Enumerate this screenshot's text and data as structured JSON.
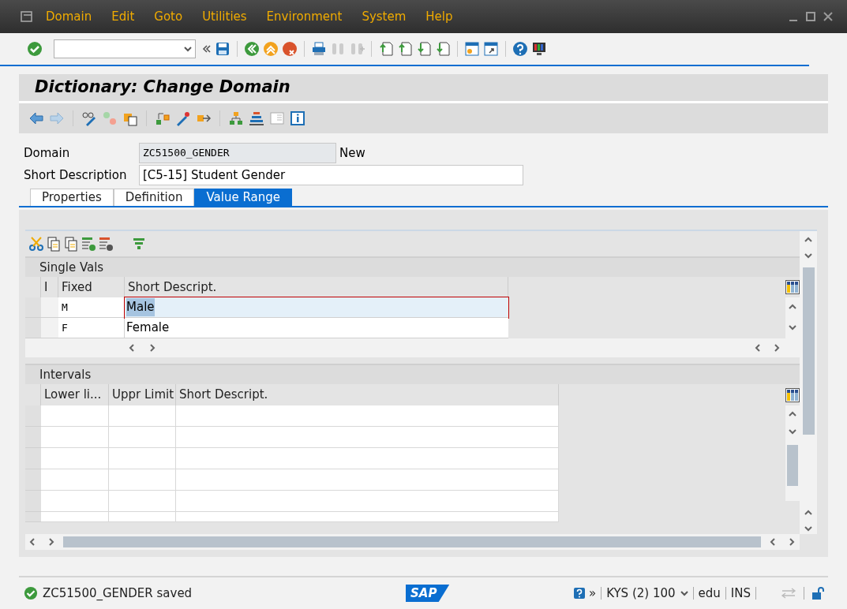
{
  "menu_bar": {
    "items": [
      "Domain",
      "Edit",
      "Goto",
      "Utilities",
      "Environment",
      "System",
      "Help"
    ]
  },
  "screen_title": "Dictionary: Change Domain",
  "fields": [
    {
      "label": "Domain",
      "value": "ZC51500_GENDER",
      "kind": "readonly",
      "note": "New"
    },
    {
      "label": "Short Description",
      "value": "[C5-15] Student Gender",
      "kind": "input"
    }
  ],
  "tabs": [
    {
      "label": "Properties",
      "selected": false
    },
    {
      "label": "Definition",
      "selected": false
    },
    {
      "label": "Value Range",
      "selected": true
    }
  ],
  "single_values": {
    "title": "Single Vals",
    "columns": [
      "I",
      "Fixed",
      "Short Descript."
    ],
    "rows": [
      {
        "fixed": "M",
        "description": "Male",
        "selected": true
      },
      {
        "fixed": "F",
        "description": "Female",
        "selected": false
      }
    ]
  },
  "intervals": {
    "title": "Intervals",
    "columns": [
      "Lower li...",
      "Uppr Limit",
      "Short Descript."
    ]
  },
  "status_bar": {
    "message": "ZC51500_GENDER saved",
    "logo": "SAP",
    "more": "»",
    "system": "KYS (2) 100",
    "client_user": "edu",
    "mode": "INS"
  }
}
